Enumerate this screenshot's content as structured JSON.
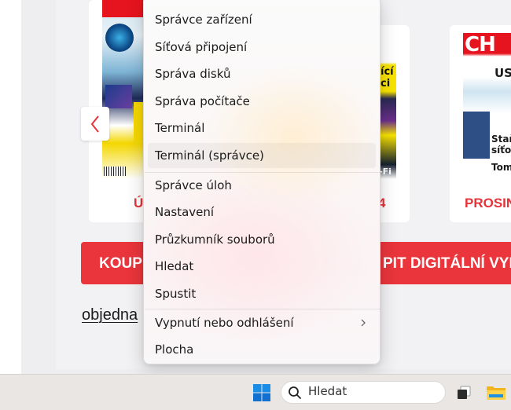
{
  "website": {
    "cover_logo": "CH",
    "cover2_text_1": "ící",
    "cover2_text_2": "ci",
    "cover2_text_3": "-Fi",
    "cover3_title": "US",
    "cover3_line_1": "Staň",
    "cover3_line_2": "síťov",
    "cover3_line_3": "Tom",
    "caption_1": "Ú",
    "caption_2": "4",
    "caption_3": "PROSIN",
    "banner_left": "KOUP",
    "banner_right": "PIT DIGITÁLNÍ VYD",
    "link": "objedna"
  },
  "context_menu": {
    "items": [
      "Správce zařízení",
      "Síťová připojení",
      "Správa disků",
      "Správa počítače",
      "Terminál",
      "Terminál (správce)",
      "Správce úloh",
      "Nastavení",
      "Průzkumník souborů",
      "Hledat",
      "Spustit",
      "Vypnutí nebo odhlášení",
      "Plocha"
    ]
  },
  "taskbar": {
    "search_placeholder": "Hledat"
  },
  "colors": {
    "accent_red": "#e9353b",
    "windows_blue": "#0f78d4"
  },
  "icons": [
    "chevron-left-icon",
    "chevron-right-icon",
    "windows-logo-icon",
    "search-icon",
    "task-view-icon",
    "file-explorer-icon"
  ]
}
